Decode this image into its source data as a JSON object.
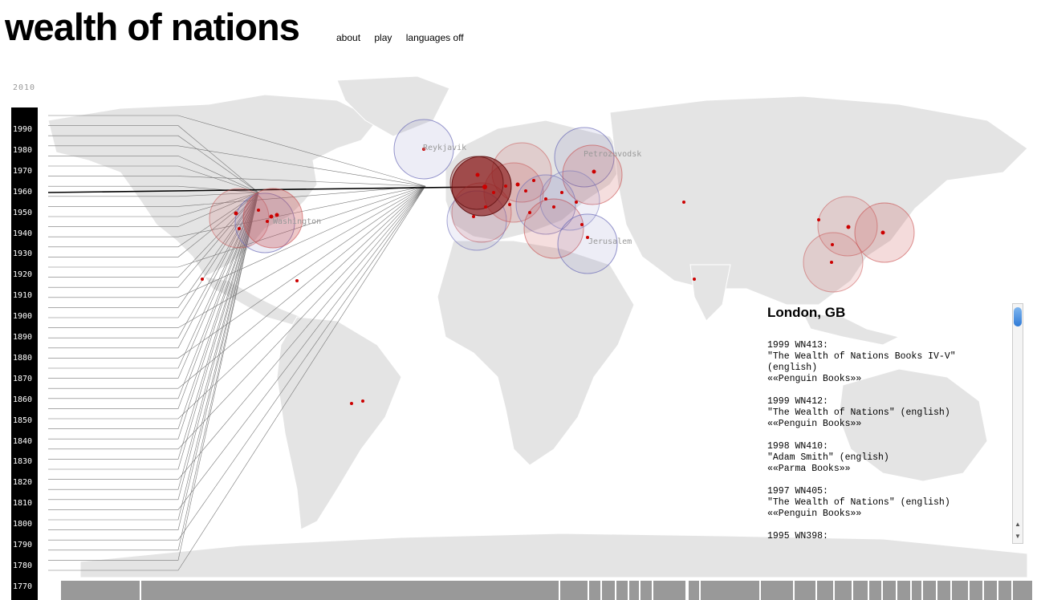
{
  "header": {
    "title": "wealth of nations",
    "nav": [
      "about",
      "play",
      "languages off"
    ]
  },
  "timeline": {
    "top_year": "2010",
    "ticks": [
      "1990",
      "1980",
      "1970",
      "1960",
      "1950",
      "1940",
      "1930",
      "1920",
      "1910",
      "1900",
      "1890",
      "1880",
      "1870",
      "1860",
      "1850",
      "1840",
      "1830",
      "1820",
      "1810",
      "1800",
      "1790",
      "1780",
      "1770"
    ]
  },
  "map": {
    "city_labels": [
      "Reykjavik",
      "Petrozavodsk",
      "Jerusalem",
      "Washington"
    ],
    "colors": {
      "red_circle": "#c84a4a",
      "blue_circle": "#6b6bb8",
      "dark_red": "#8b1a1a",
      "land": "#e4e4e4"
    }
  },
  "info": {
    "title": "London, GB",
    "entries": [
      "1999 WN413:\n\"The Wealth of Nations Books IV-V\"\n(english)\n««Penguin Books»»",
      "1999 WN412:\n\"The Wealth of Nations\" (english)\n««Penguin Books»»",
      "1998 WN410:\n\"Adam Smith\" (english)\n««Parma Books»»",
      "1997 WN405:\n\"The Wealth of Nations\" (english)\n««Penguin Books»»",
      "1995 WN398:"
    ]
  },
  "scrollbar": {
    "up_icon": "▲",
    "down_icon": "▼"
  }
}
